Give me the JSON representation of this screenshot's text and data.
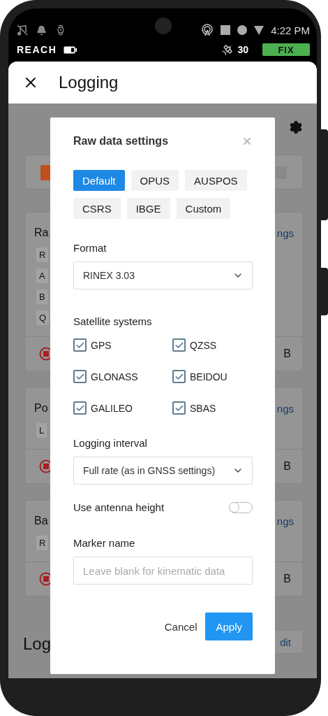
{
  "status_bar": {
    "time": "4:22 PM",
    "device": "REACH",
    "satellites": "30",
    "fix": "FIX"
  },
  "app_bar": {
    "title": "Logging"
  },
  "background": {
    "cards": [
      {
        "kind": "status"
      },
      {
        "kind": "log",
        "title": "Ra",
        "link": "ngs",
        "chips": [
          "R",
          "A",
          "B",
          "Q"
        ],
        "size": "B"
      },
      {
        "kind": "log",
        "title": "Po",
        "link": "ngs",
        "chips": [
          "L"
        ],
        "size": "B"
      },
      {
        "kind": "log",
        "title": "Ba",
        "link": "ngs",
        "chips": [
          "R"
        ],
        "size": "B"
      }
    ],
    "logs_title": "Log",
    "logs_link": "dit"
  },
  "dialog": {
    "title": "Raw data settings",
    "presets": [
      {
        "label": "Default",
        "selected": true
      },
      {
        "label": "OPUS",
        "selected": false
      },
      {
        "label": "AUSPOS",
        "selected": false
      },
      {
        "label": "CSRS",
        "selected": false
      },
      {
        "label": "IBGE",
        "selected": false
      },
      {
        "label": "Custom",
        "selected": false
      }
    ],
    "format": {
      "label": "Format",
      "value": "RINEX 3.03"
    },
    "satellite_systems": {
      "label": "Satellite systems",
      "items": [
        {
          "label": "GPS",
          "checked": true
        },
        {
          "label": "QZSS",
          "checked": true
        },
        {
          "label": "GLONASS",
          "checked": true
        },
        {
          "label": "BEIDOU",
          "checked": true
        },
        {
          "label": "GALILEO",
          "checked": true
        },
        {
          "label": "SBAS",
          "checked": true
        }
      ]
    },
    "logging_interval": {
      "label": "Logging interval",
      "value": "Full rate (as in GNSS settings)"
    },
    "antenna_height": {
      "label": "Use antenna height",
      "on": false
    },
    "marker_name": {
      "label": "Marker name",
      "placeholder": "Leave blank for kinematic data"
    },
    "buttons": {
      "cancel": "Cancel",
      "apply": "Apply"
    }
  }
}
